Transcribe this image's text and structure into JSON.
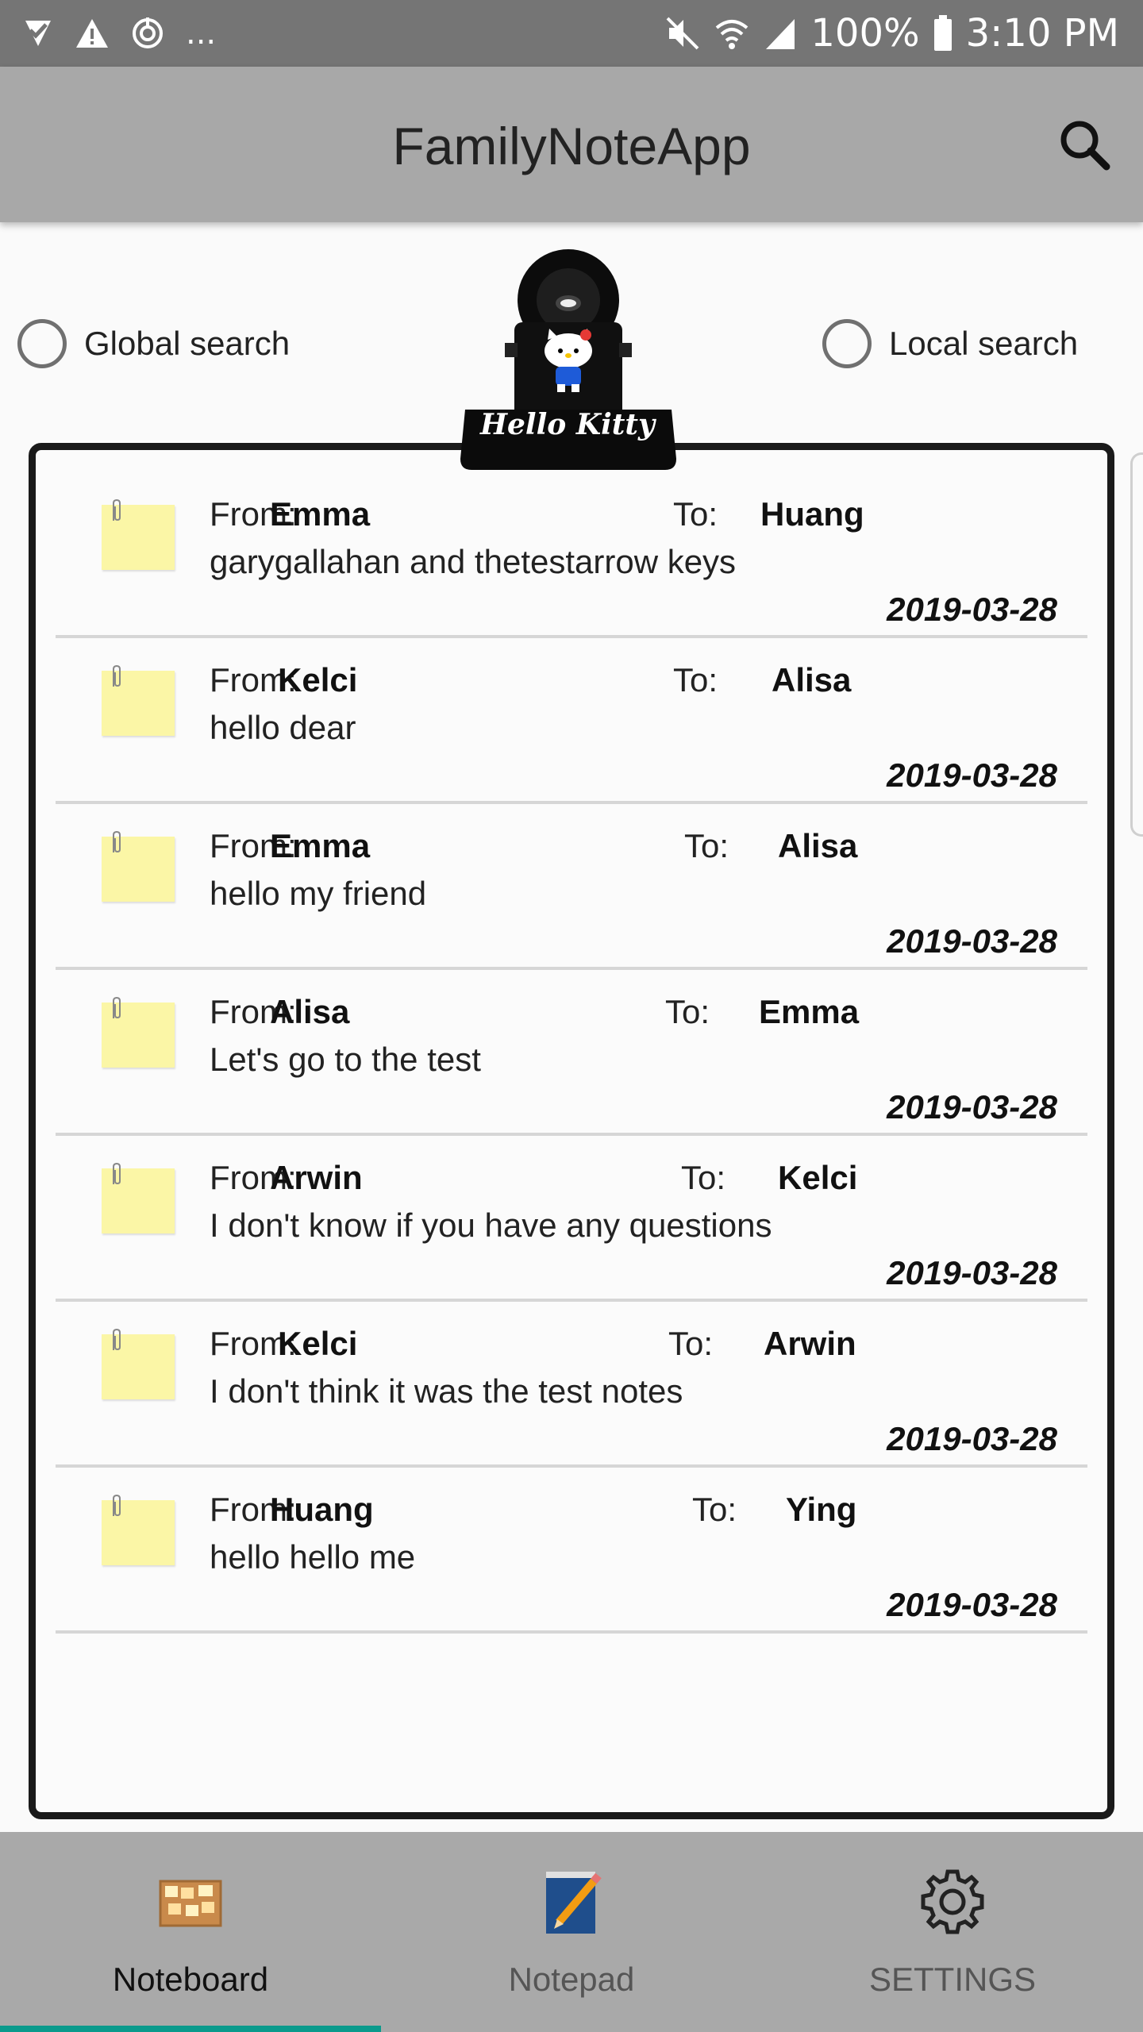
{
  "status_bar": {
    "ellipsis": "...",
    "battery": "100%",
    "time": "3:10 PM"
  },
  "app_bar": {
    "title": "FamilyNoteApp"
  },
  "search_options": {
    "global": "Global search",
    "local": "Local search"
  },
  "clipboard": {
    "label": "Hello Kitty"
  },
  "note_labels": {
    "from": "From:",
    "to": "To:"
  },
  "notes": [
    {
      "from": "Emma",
      "to": "Huang",
      "message": "garygallahan and thetestarrow keys",
      "date": "2019-03-28"
    },
    {
      "from": "Kelci",
      "to": "Alisa",
      "message": "hello dear",
      "date": "2019-03-28"
    },
    {
      "from": "Emma",
      "to": "Alisa",
      "message": "hello my friend",
      "date": "2019-03-28"
    },
    {
      "from": "Alisa",
      "to": "Emma",
      "message": "Let's go to the test",
      "date": "2019-03-28"
    },
    {
      "from": "Arwin",
      "to": "Kelci",
      "message": "I don't know if you have any questions",
      "date": "2019-03-28"
    },
    {
      "from": "Kelci",
      "to": "Arwin",
      "message": "I don't think it was the test notes",
      "date": "2019-03-28"
    },
    {
      "from": "Huang",
      "to": "Ying",
      "message": "hello hello me",
      "date": "2019-03-28"
    }
  ],
  "bottom_nav": {
    "tabs": [
      {
        "label": "Noteboard",
        "icon": "corkboard-icon",
        "active": true
      },
      {
        "label": "Notepad",
        "icon": "notepad-pencil-icon",
        "active": false
      },
      {
        "label": "SETTINGS",
        "icon": "gear-icon",
        "active": false
      }
    ]
  },
  "colors": {
    "status_bar": "#757575",
    "app_bar": "#a8a8a8",
    "bottom_nav": "#a9a9a9",
    "active_indicator": "#0a9a8c",
    "sticky_note": "#fbf6a6"
  }
}
